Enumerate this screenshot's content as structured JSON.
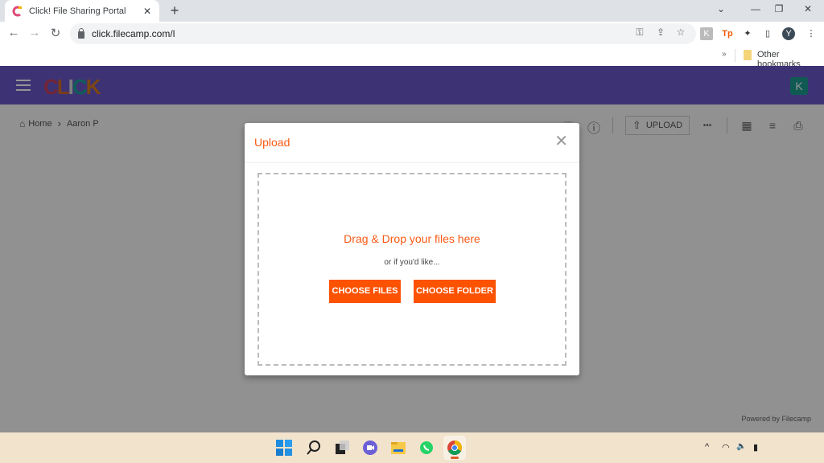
{
  "browser": {
    "tab_title": "Click! File Sharing Portal",
    "tab_close": "✕",
    "new_tab": "+",
    "url": "click.filecamp.com/l",
    "bookmarks_more": "»",
    "other_bookmarks": "Other bookmarks",
    "profile_initial": "Y",
    "window_controls": {
      "tabsearch": "⌄",
      "minimize": "—",
      "restore": "❐",
      "close": "✕"
    },
    "nav": {
      "back": "←",
      "forward": "→",
      "reload": "↻"
    },
    "omnibox_icons": {
      "key": "⚿",
      "share": "⇪",
      "star": "☆"
    },
    "extensions": {
      "ext1": "K",
      "ext2": "Tp",
      "puzzle": "✦",
      "sidepanel": "▯",
      "menu": "⋮"
    }
  },
  "app": {
    "logo_letters": [
      "C",
      "L",
      "I",
      "C",
      "K"
    ],
    "logo_colors": [
      "#c8415f",
      "#d06a2a",
      "#d9d9d9",
      "#1aa39a",
      "#d77a1f"
    ],
    "avatar_initial": "K",
    "breadcrumb": {
      "home": "Home",
      "separator": "›",
      "current": "Aaron P"
    },
    "toolbar": {
      "upload_label": "UPLOAD",
      "upload_icon": "⇧",
      "more_icon": "•••",
      "info_icon": "ⓘ",
      "search_icon": "○",
      "heart_icon": "♡",
      "grid_icon": "▦",
      "sort_icon": "≡",
      "print_icon": "⎙"
    },
    "powered_by": "Powered by Filecamp",
    "accent_color": "#fd5200",
    "header_color": "#6a58c8"
  },
  "modal": {
    "title": "Upload",
    "close": "✕",
    "drop_heading": "Drag & Drop your files here",
    "drop_sub": "or if you'd like...",
    "choose_files": "CHOOSE FILES",
    "choose_folder": "CHOOSE FOLDER"
  },
  "taskbar": {
    "tray_up": "^",
    "wifi": "◠",
    "volume": "🔈",
    "battery": "▮"
  }
}
